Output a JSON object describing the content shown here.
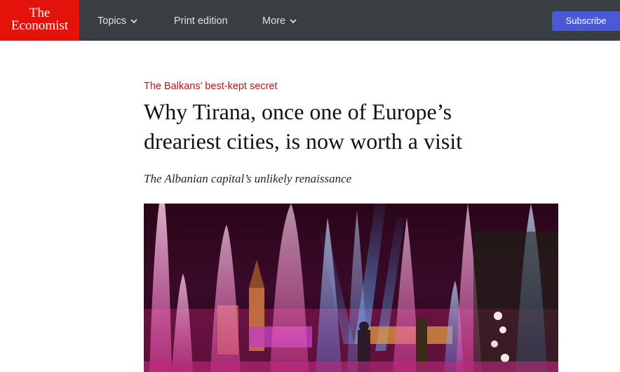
{
  "header": {
    "logo": {
      "line1": "The",
      "line2": "Economist"
    },
    "nav": [
      {
        "label": "Topics",
        "has_dropdown": true
      },
      {
        "label": "Print edition",
        "has_dropdown": false
      },
      {
        "label": "More",
        "has_dropdown": true
      }
    ],
    "subscribe_label": "Subscribe"
  },
  "article": {
    "rubric": "The Balkans’ best-kept secret",
    "headline_line1": "Why Tirana, once one of Europe’s",
    "headline_line2": "dreariest cities, is now worth a visit",
    "standfirst": "The Albanian capital’s unlikely renaissance"
  },
  "colors": {
    "brand_red": "#e3120b",
    "nav_bg": "#383e42",
    "subscribe_bg": "#4a5ad6",
    "rubric_red": "#c3111b"
  }
}
